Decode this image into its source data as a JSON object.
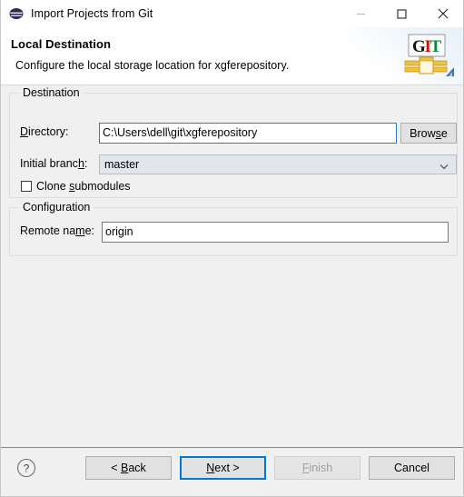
{
  "window": {
    "title": "Import Projects from Git",
    "icon": "eclipse-icon",
    "controls": {
      "minimize": "minimize-icon",
      "maximize": "maximize-icon",
      "close": "close-icon"
    }
  },
  "header": {
    "title": "Local Destination",
    "subtitle": "Configure the local storage location for xgferepository.",
    "logo": {
      "name": "git-banner-logo",
      "letters": [
        "G",
        "I",
        "T"
      ],
      "colors": {
        "g": "#000000",
        "i": "#cc0000",
        "t": "#007a3d",
        "band": "#e8a93a"
      }
    }
  },
  "destination": {
    "group_label": "Destination",
    "directory": {
      "label": "Directory:",
      "label_mnemonic": "D",
      "value": "C:\\Users\\dell\\git\\xgferepository",
      "placeholder": "",
      "focused": true
    },
    "browse": {
      "label": "Browse",
      "mnemonic": "s"
    },
    "initial_branch": {
      "label": "Initial branch:",
      "label_mnemonic": "h",
      "value": "master",
      "options": [
        "master"
      ]
    },
    "clone_submodules": {
      "label": "Clone submodules",
      "mnemonic": "s",
      "checked": false
    }
  },
  "configuration": {
    "group_label": "Configuration",
    "remote_name": {
      "label": "Remote name:",
      "label_mnemonic": "m",
      "value": "origin",
      "placeholder": ""
    }
  },
  "footer": {
    "help": "help-icon",
    "buttons": [
      {
        "label": "< Back",
        "mnemonic": "B",
        "state": "enabled"
      },
      {
        "label": "Next >",
        "mnemonic": "N",
        "state": "focused"
      },
      {
        "label": "Finish",
        "mnemonic": "F",
        "state": "disabled"
      },
      {
        "label": "Cancel",
        "mnemonic": "",
        "state": "enabled"
      }
    ]
  },
  "colors": {
    "dialog_bg": "#f0f0f0",
    "accent": "#0078d7",
    "field_focus": "#2a7cc7",
    "combo_bg": "#e2e6ec"
  }
}
